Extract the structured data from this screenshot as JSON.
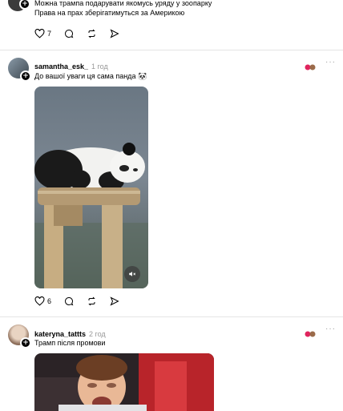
{
  "post_top": {
    "lines": [
      "Можна трампа подарувати якомусь уряду у зоопарку",
      "Права на прах зберігатимуться за Америкою"
    ],
    "likes": "7"
  },
  "post_panda": {
    "username": "samantha_esk_",
    "time": "1 год",
    "text": "До вашої уваги ця сама панда 🐼",
    "likes": "6"
  },
  "post_trump": {
    "username": "kateryna_tattts",
    "time": "2 год",
    "text": "Трамп після промови"
  },
  "icons": {
    "like": "heart-icon",
    "comment": "comment-icon",
    "repost": "repost-icon",
    "share": "send-icon",
    "mute": "speaker-muted-icon",
    "more": "more-icon"
  }
}
